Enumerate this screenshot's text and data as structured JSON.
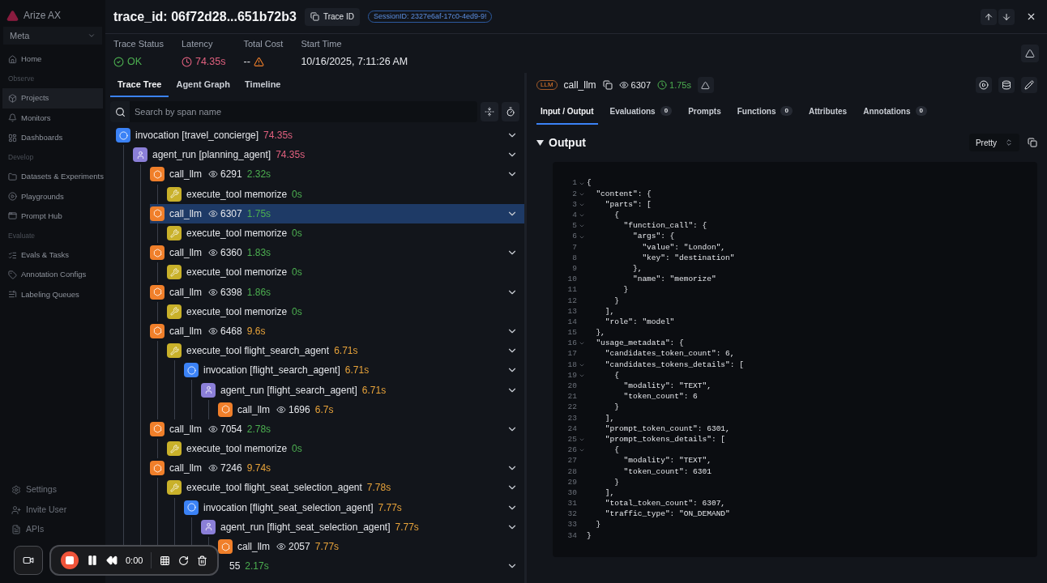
{
  "brand": {
    "name": "Arize AX"
  },
  "workspace": {
    "label": "Meta"
  },
  "sidebar": {
    "items": [
      {
        "kind": "item",
        "label": "Home",
        "selected": false
      },
      {
        "kind": "section",
        "label": "Observe"
      },
      {
        "kind": "item",
        "label": "Projects",
        "selected": true
      },
      {
        "kind": "item",
        "label": "Monitors",
        "selected": false
      },
      {
        "kind": "item",
        "label": "Dashboards",
        "selected": false
      },
      {
        "kind": "section",
        "label": "Develop"
      },
      {
        "kind": "item",
        "label": "Datasets & Experiments",
        "selected": false
      },
      {
        "kind": "item",
        "label": "Playgrounds",
        "selected": false
      },
      {
        "kind": "item",
        "label": "Prompt Hub",
        "selected": false
      },
      {
        "kind": "section",
        "label": "Evaluate"
      },
      {
        "kind": "item",
        "label": "Evals & Tasks",
        "selected": false
      },
      {
        "kind": "item",
        "label": "Annotation Configs",
        "selected": false
      },
      {
        "kind": "item",
        "label": "Labeling Queues",
        "selected": false
      }
    ],
    "footer": [
      {
        "label": "Settings"
      },
      {
        "label": "Invite User"
      },
      {
        "label": "APIs"
      }
    ]
  },
  "trace": {
    "title": "trace_id: 06f72d28...651b72b3",
    "copy_button": "Trace ID",
    "session": "SessionID: 2327e6af-17c0-4ed9-9!"
  },
  "stats": [
    {
      "kind": "status",
      "label": "Trace Status",
      "value": "OK"
    },
    {
      "kind": "latency",
      "label": "Latency",
      "value": "74.35s"
    },
    {
      "kind": "cost",
      "label": "Total Cost",
      "value": "--"
    },
    {
      "kind": "plain",
      "label": "Start Time",
      "value": "10/16/2025, 7:11:26 AM"
    }
  ],
  "left_tabs": [
    {
      "label": "Trace Tree",
      "selected": true
    },
    {
      "label": "Agent Graph",
      "selected": false
    },
    {
      "label": "Timeline",
      "selected": false
    }
  ],
  "search": {
    "placeholder": "Search by span name"
  },
  "tree": [
    {
      "kind": "invocation",
      "label": "invocation [travel_concierge]",
      "duration": "74.35s",
      "color": "#e0607e",
      "collapsible": true,
      "selected": false,
      "children": [
        {
          "kind": "agent",
          "label": "agent_run [planning_agent]",
          "duration": "74.35s",
          "color": "#e0607e",
          "collapsible": true,
          "selected": false,
          "children": [
            {
              "kind": "llm",
              "label": "call_llm",
              "tokens": "6291",
              "duration": "2.32s",
              "color": "#4caf50",
              "collapsible": true,
              "selected": false,
              "children": [
                {
                  "kind": "tool",
                  "label": "execute_tool memorize",
                  "duration": "0s",
                  "color": "#4caf50",
                  "collapsible": false,
                  "selected": false
                }
              ]
            },
            {
              "kind": "llm",
              "label": "call_llm",
              "tokens": "6307",
              "duration": "1.75s",
              "color": "#4caf50",
              "collapsible": true,
              "selected": true,
              "children": [
                {
                  "kind": "tool",
                  "label": "execute_tool memorize",
                  "duration": "0s",
                  "color": "#4caf50",
                  "collapsible": false,
                  "selected": false
                }
              ]
            },
            {
              "kind": "llm",
              "label": "call_llm",
              "tokens": "6360",
              "duration": "1.83s",
              "color": "#4caf50",
              "collapsible": true,
              "selected": false,
              "children": [
                {
                  "kind": "tool",
                  "label": "execute_tool memorize",
                  "duration": "0s",
                  "color": "#4caf50",
                  "collapsible": false,
                  "selected": false
                }
              ]
            },
            {
              "kind": "llm",
              "label": "call_llm",
              "tokens": "6398",
              "duration": "1.86s",
              "color": "#4caf50",
              "collapsible": true,
              "selected": false,
              "children": [
                {
                  "kind": "tool",
                  "label": "execute_tool memorize",
                  "duration": "0s",
                  "color": "#4caf50",
                  "collapsible": false,
                  "selected": false
                }
              ]
            },
            {
              "kind": "llm",
              "label": "call_llm",
              "tokens": "6468",
              "duration": "9.6s",
              "color": "#e8a33a",
              "collapsible": true,
              "selected": false,
              "children": [
                {
                  "kind": "tool",
                  "label": "execute_tool flight_search_agent",
                  "duration": "6.71s",
                  "color": "#e8a33a",
                  "collapsible": true,
                  "selected": false,
                  "children": [
                    {
                      "kind": "invocation",
                      "label": "invocation [flight_search_agent]",
                      "duration": "6.71s",
                      "color": "#e8a33a",
                      "collapsible": true,
                      "selected": false,
                      "children": [
                        {
                          "kind": "agent",
                          "label": "agent_run [flight_search_agent]",
                          "duration": "6.71s",
                          "color": "#e8a33a",
                          "collapsible": true,
                          "selected": false,
                          "children": [
                            {
                              "kind": "llm",
                              "label": "call_llm",
                              "tokens": "1696",
                              "duration": "6.7s",
                              "color": "#e8a33a",
                              "collapsible": false,
                              "selected": false
                            }
                          ]
                        }
                      ]
                    }
                  ]
                }
              ]
            },
            {
              "kind": "llm",
              "label": "call_llm",
              "tokens": "7054",
              "duration": "2.78s",
              "color": "#4caf50",
              "collapsible": true,
              "selected": false,
              "children": [
                {
                  "kind": "tool",
                  "label": "execute_tool memorize",
                  "duration": "0s",
                  "color": "#4caf50",
                  "collapsible": false,
                  "selected": false
                }
              ]
            },
            {
              "kind": "llm",
              "label": "call_llm",
              "tokens": "7246",
              "duration": "9.74s",
              "color": "#e8a33a",
              "collapsible": true,
              "selected": false,
              "children": [
                {
                  "kind": "tool",
                  "label": "execute_tool flight_seat_selection_agent",
                  "duration": "7.78s",
                  "color": "#e8a33a",
                  "collapsible": true,
                  "selected": false,
                  "children": [
                    {
                      "kind": "invocation",
                      "label": "invocation [flight_seat_selection_agent]",
                      "duration": "7.77s",
                      "color": "#e8a33a",
                      "collapsible": true,
                      "selected": false,
                      "children": [
                        {
                          "kind": "agent",
                          "label": "agent_run [flight_seat_selection_agent]",
                          "duration": "7.77s",
                          "color": "#e8a33a",
                          "collapsible": true,
                          "selected": false,
                          "children": [
                            {
                              "kind": "llm",
                              "label": "call_llm",
                              "tokens": "2057",
                              "duration": "7.77s",
                              "color": "#e8a33a",
                              "collapsible": false,
                              "selected": false
                            }
                          ]
                        }
                      ]
                    }
                  ]
                }
              ]
            },
            {
              "kind": "covered",
              "tokens": "55",
              "duration": "2.17s",
              "color": "#4caf50",
              "collapsible": true,
              "selected": false
            }
          ]
        }
      ]
    }
  ],
  "span": {
    "badge": "LLM",
    "name": "call_llm",
    "tokens": "6307",
    "duration": "1.75s"
  },
  "right_tabs": [
    {
      "label": "Input / Output",
      "selected": true
    },
    {
      "label": "Evaluations",
      "count": "0",
      "selected": false
    },
    {
      "label": "Prompts",
      "selected": false
    },
    {
      "label": "Functions",
      "count": "0",
      "selected": false
    },
    {
      "label": "Attributes",
      "selected": false
    },
    {
      "label": "Annotations",
      "count": "0",
      "selected": false
    }
  ],
  "output": {
    "title": "Output",
    "expanded": true,
    "format": "Pretty",
    "lines": [
      {
        "n": "1",
        "fold": true,
        "text": "{"
      },
      {
        "n": "2",
        "fold": true,
        "text": "  \"content\": {"
      },
      {
        "n": "3",
        "fold": true,
        "text": "    \"parts\": ["
      },
      {
        "n": "4",
        "fold": true,
        "text": "      {"
      },
      {
        "n": "5",
        "fold": true,
        "text": "        \"function_call\": {"
      },
      {
        "n": "6",
        "fold": true,
        "text": "          \"args\": {"
      },
      {
        "n": "7",
        "fold": false,
        "text": "            \"value\": \"London\","
      },
      {
        "n": "8",
        "fold": false,
        "text": "            \"key\": \"destination\""
      },
      {
        "n": "9",
        "fold": false,
        "text": "          },"
      },
      {
        "n": "10",
        "fold": false,
        "text": "          \"name\": \"memorize\""
      },
      {
        "n": "11",
        "fold": false,
        "text": "        }"
      },
      {
        "n": "12",
        "fold": false,
        "text": "      }"
      },
      {
        "n": "13",
        "fold": false,
        "text": "    ],"
      },
      {
        "n": "14",
        "fold": false,
        "text": "    \"role\": \"model\""
      },
      {
        "n": "15",
        "fold": false,
        "text": "  },"
      },
      {
        "n": "16",
        "fold": true,
        "text": "  \"usage_metadata\": {"
      },
      {
        "n": "17",
        "fold": false,
        "text": "    \"candidates_token_count\": 6,"
      },
      {
        "n": "18",
        "fold": true,
        "text": "    \"candidates_tokens_details\": ["
      },
      {
        "n": "19",
        "fold": true,
        "text": "      {"
      },
      {
        "n": "20",
        "fold": false,
        "text": "        \"modality\": \"TEXT\","
      },
      {
        "n": "21",
        "fold": false,
        "text": "        \"token_count\": 6"
      },
      {
        "n": "22",
        "fold": false,
        "text": "      }"
      },
      {
        "n": "23",
        "fold": false,
        "text": "    ],"
      },
      {
        "n": "24",
        "fold": false,
        "text": "    \"prompt_token_count\": 6301,"
      },
      {
        "n": "25",
        "fold": true,
        "text": "    \"prompt_tokens_details\": ["
      },
      {
        "n": "26",
        "fold": true,
        "text": "      {"
      },
      {
        "n": "27",
        "fold": false,
        "text": "        \"modality\": \"TEXT\","
      },
      {
        "n": "28",
        "fold": false,
        "text": "        \"token_count\": 6301"
      },
      {
        "n": "29",
        "fold": false,
        "text": "      }"
      },
      {
        "n": "30",
        "fold": false,
        "text": "    ],"
      },
      {
        "n": "31",
        "fold": false,
        "text": "    \"total_token_count\": 6307,"
      },
      {
        "n": "32",
        "fold": false,
        "text": "    \"traffic_type\": \"ON_DEMAND\""
      },
      {
        "n": "33",
        "fold": false,
        "text": "  }"
      },
      {
        "n": "34",
        "fold": false,
        "text": "}"
      }
    ]
  },
  "recorder": {
    "time": "0:00",
    "recording": true
  }
}
